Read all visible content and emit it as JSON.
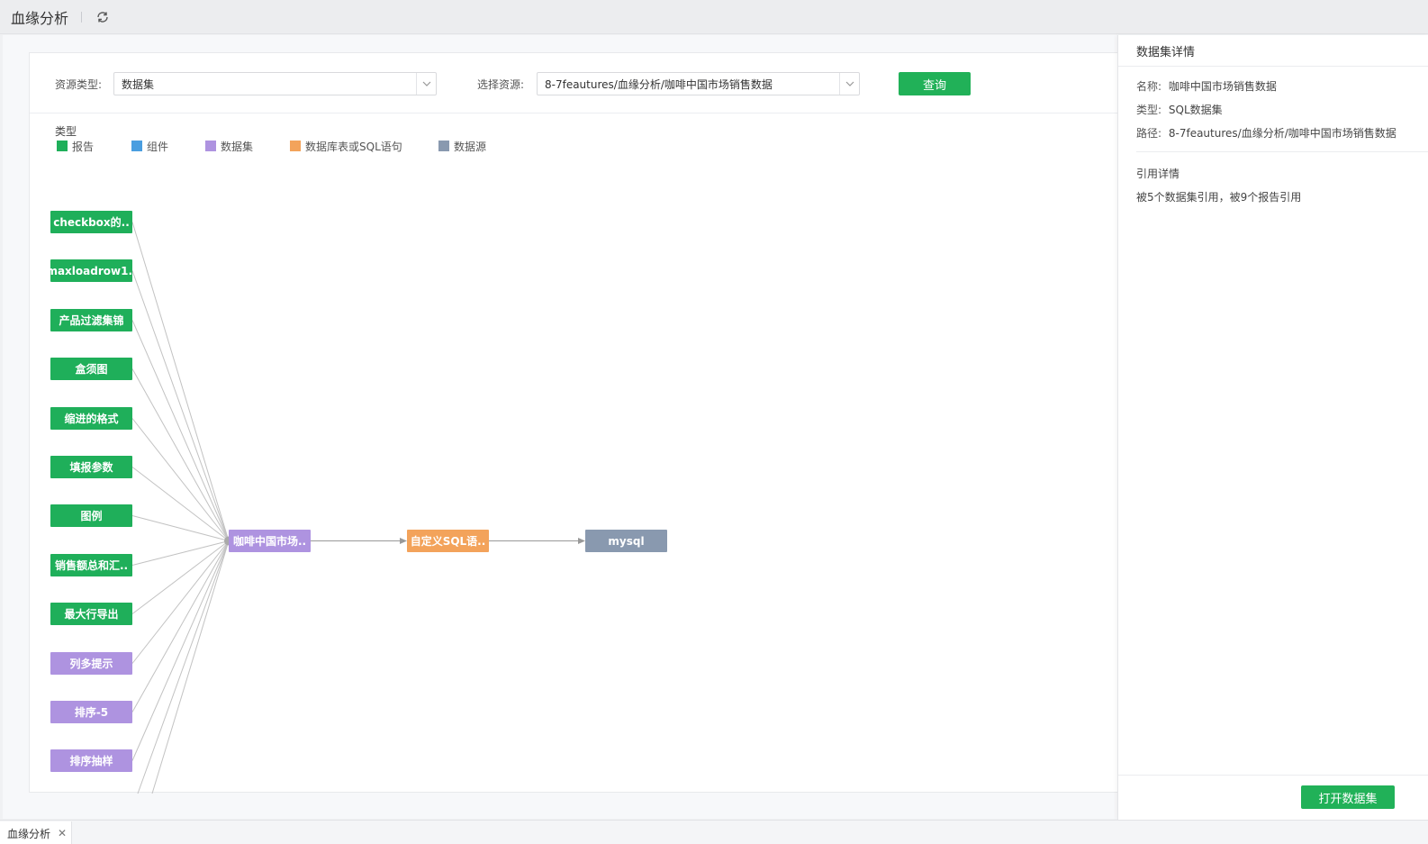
{
  "titlebar": {
    "title": "血缘分析",
    "refresh_icon": "refresh-icon"
  },
  "filter": {
    "resource_type_label": "资源类型:",
    "resource_type_value": "数据集",
    "select_resource_label": "选择资源:",
    "select_resource_value": "8-7feautures/血缘分析/咖啡中国市场销售数据",
    "query_button": "查询"
  },
  "legend": {
    "title": "类型",
    "items": [
      {
        "label": "报告",
        "color": "#1faf5a"
      },
      {
        "label": "组件",
        "color": "#4a9ee0"
      },
      {
        "label": "数据集",
        "color": "#ae93e0"
      },
      {
        "label": "数据库表或SQL语句",
        "color": "#f3a35b"
      },
      {
        "label": "数据源",
        "color": "#8999af"
      }
    ]
  },
  "graph": {
    "left_nodes": [
      {
        "label": "checkbox的..",
        "type": "report"
      },
      {
        "label": "maxloadrow1..",
        "type": "report"
      },
      {
        "label": "产品过滤集锦",
        "type": "report"
      },
      {
        "label": "盒须图",
        "type": "report"
      },
      {
        "label": "缩进的格式",
        "type": "report"
      },
      {
        "label": "填报参数",
        "type": "report"
      },
      {
        "label": "图例",
        "type": "report"
      },
      {
        "label": "销售额总和汇..",
        "type": "report"
      },
      {
        "label": "最大行导出",
        "type": "report"
      },
      {
        "label": "列多提示",
        "type": "dataset"
      },
      {
        "label": "排序-5",
        "type": "dataset"
      },
      {
        "label": "排序抽样",
        "type": "dataset"
      }
    ],
    "center_node": {
      "label": "咖啡中国市场..",
      "type": "dataset"
    },
    "sql_node": {
      "label": "自定义SQL语..",
      "type": "sql"
    },
    "source_node": {
      "label": "mysql",
      "type": "source"
    }
  },
  "panel": {
    "title": "数据集详情",
    "name_key": "名称:",
    "name_value": "咖啡中国市场销售数据",
    "type_key": "类型:",
    "type_value": "SQL数据集",
    "path_key": "路径:",
    "path_value": "8-7feautures/血缘分析/咖啡中国市场销售数据",
    "ref_title": "引用详情",
    "ref_text": "被5个数据集引用，被9个报告引用",
    "open_button": "打开数据集"
  },
  "tabs": [
    {
      "label": "血缘分析"
    }
  ]
}
